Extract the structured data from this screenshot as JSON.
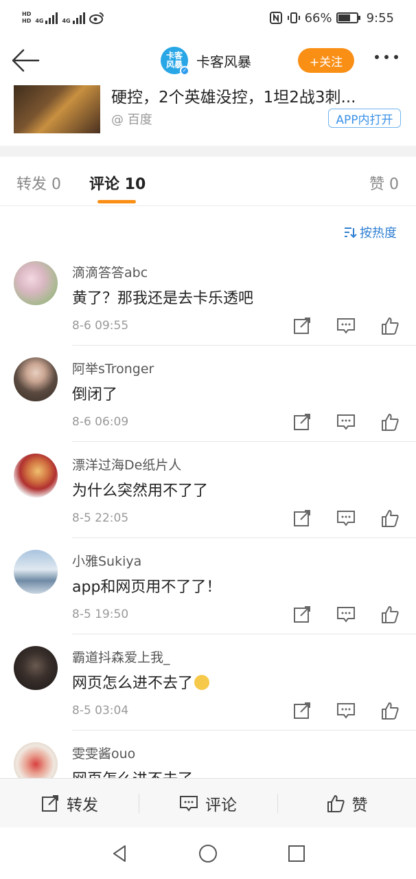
{
  "status_bar": {
    "hd1": "HD",
    "hd2": "HD",
    "sig1": "4G",
    "sig2": "4G",
    "battery_percent": "66%",
    "battery_level": 0.66,
    "time": "9:55"
  },
  "nav": {
    "avatar_text": "卡客风暴",
    "name": "卡客风暴",
    "follow_label": "+关注"
  },
  "card": {
    "title": "硬控，2个英雄没控，1坦2战3刺...",
    "source": "@ 百度",
    "open_app_label": "APP内打开"
  },
  "tabs": {
    "repost": "转发 0",
    "comment": "评论 10",
    "like": "赞 0"
  },
  "sort_label": "按热度",
  "comments": [
    {
      "name": "滴滴答答abc",
      "text": "黄了？那我还是去卡乐透吧",
      "time": "8-6 09:55"
    },
    {
      "name": "阿举sTronger",
      "text": "倒闭了",
      "time": "8-6 06:09"
    },
    {
      "name": "漂洋过海De纸片人",
      "text": "为什么突然用不了了",
      "time": "8-5 22:05"
    },
    {
      "name": "小雅Sukiya",
      "text": "app和网页用不了了！",
      "time": "8-5 19:50"
    },
    {
      "name": "霸道抖森爱上我_",
      "text": "网页怎么进不去了",
      "time": "8-5 03:04"
    },
    {
      "name": "雯雯酱ouo",
      "text": "网页怎么进不去了"
    }
  ],
  "bottom_bar": {
    "repost": "转发",
    "comment": "评论",
    "like": "赞"
  }
}
